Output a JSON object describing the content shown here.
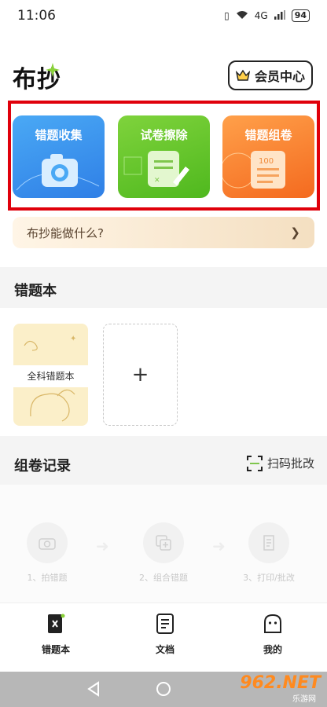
{
  "status_bar": {
    "time": "11:06",
    "network": "4G",
    "battery": "94"
  },
  "header": {
    "app_title": "布抄",
    "vip_label": "会员中心"
  },
  "features": [
    {
      "label": "错题收集",
      "icon": "camera-icon"
    },
    {
      "label": "试卷擦除",
      "icon": "document-eraser-icon"
    },
    {
      "label": "错题组卷",
      "icon": "score-paper-icon"
    }
  ],
  "help_banner": {
    "text": "布抄能做什么?"
  },
  "notebook": {
    "title": "错题本",
    "books": [
      {
        "label": "全科错题本"
      }
    ],
    "add_label": "+"
  },
  "records": {
    "title": "组卷记录",
    "scan_label": "扫码批改",
    "steps": [
      {
        "label": "1、拍错题",
        "icon": "camera-icon"
      },
      {
        "label": "2、组合错题",
        "icon": "combine-icon"
      },
      {
        "label": "3、打印/批改",
        "icon": "print-icon"
      }
    ]
  },
  "bottom_nav": [
    {
      "label": "错题本",
      "icon": "notebook-icon",
      "active": true
    },
    {
      "label": "文档",
      "icon": "document-icon",
      "active": false
    },
    {
      "label": "我的",
      "icon": "profile-icon",
      "active": false
    }
  ],
  "watermark": {
    "text": "962.NET",
    "sub": "乐游网"
  },
  "colors": {
    "highlight": "#e0000b",
    "blue_card": "#3a93ee",
    "green_card": "#66c72c",
    "orange_card": "#f8842f"
  }
}
